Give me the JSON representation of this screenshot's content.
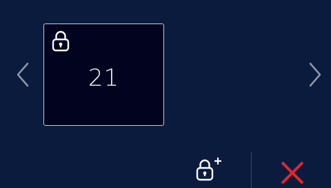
{
  "colors": {
    "background": "#0b1b3e",
    "card_background": "#02031f",
    "card_border": "#c9ccd6",
    "arrow": "#8e97ad",
    "icon": "#ffffff",
    "close": "#e0282e"
  },
  "navigation": {
    "previous_icon": "chevron-left-icon",
    "next_icon": "chevron-right-icon"
  },
  "code_card": {
    "icon": "padlock-icon",
    "number": "21"
  },
  "actions": {
    "add_lock_icon": "padlock-plus-icon",
    "close_icon": "close-x-icon"
  }
}
